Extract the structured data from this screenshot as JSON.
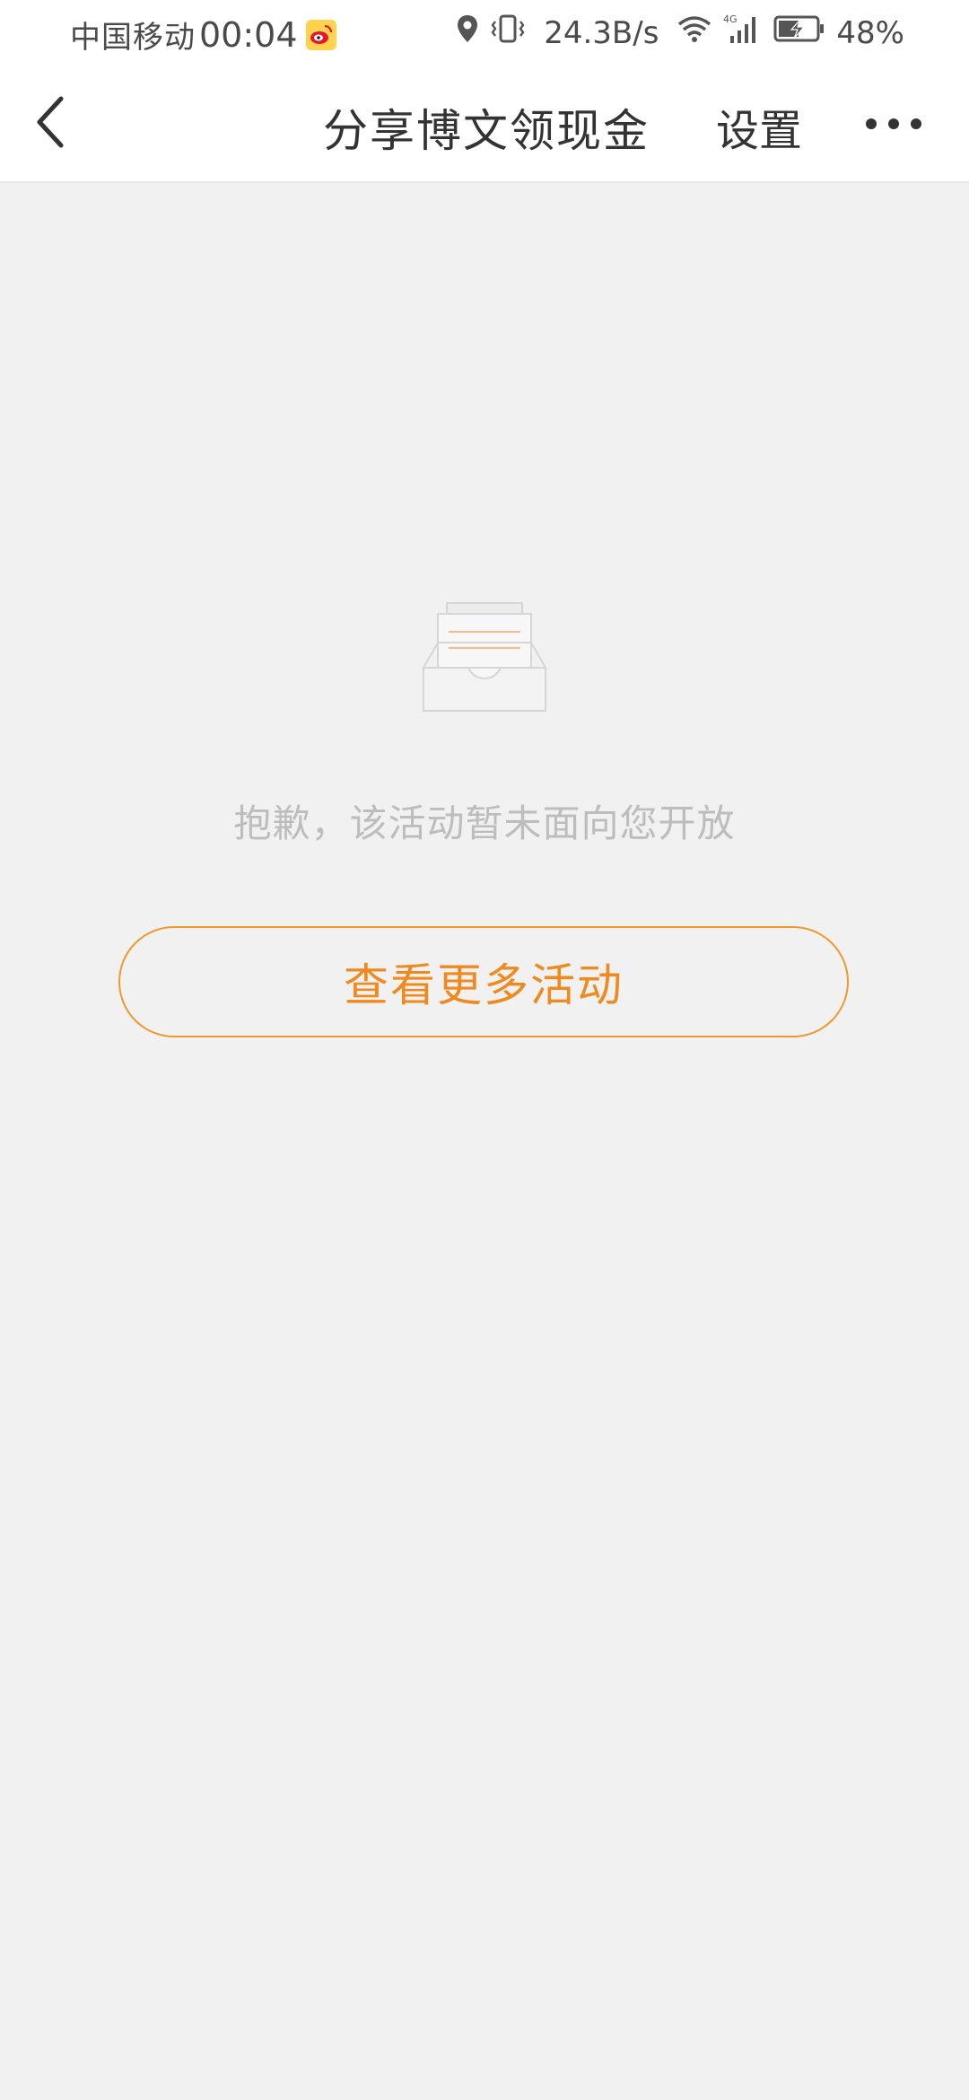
{
  "status_bar": {
    "carrier": "中国移动",
    "time": "00:04",
    "net_speed": "24.3B/s",
    "network_type": "4G",
    "battery_percent": "48%",
    "icons": [
      "weibo-icon",
      "location-icon",
      "vibrate-icon",
      "wifi-icon",
      "signal-icon",
      "battery-charging-icon"
    ]
  },
  "nav": {
    "title": "分享博文领现金",
    "settings_label": "设置",
    "back_icon": "chevron-left-icon",
    "more_icon": "more-horizontal-icon"
  },
  "empty_state": {
    "icon": "empty-inbox-icon",
    "message": "抱歉，该活动暂未面向您开放",
    "button_label": "查看更多活动"
  },
  "colors": {
    "accent": "#f08a1e",
    "background": "#f1f1f1",
    "muted_text": "#bdbdbd",
    "title_text": "#333333"
  }
}
